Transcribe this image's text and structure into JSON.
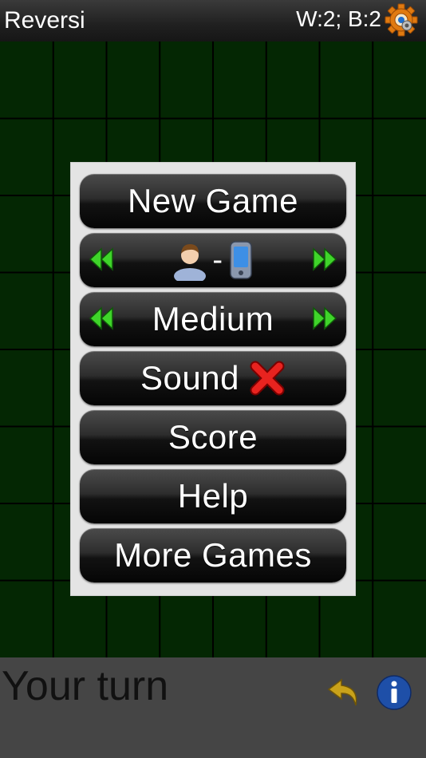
{
  "header": {
    "title": "Reversi",
    "score": "W:2; B:2",
    "settings_icon": "gear-icon"
  },
  "menu": {
    "new_game": "New Game",
    "mode": {
      "player_icon": "person-icon",
      "separator": "-",
      "opponent_icon": "phone-icon",
      "prev_icon": "double-left-arrow-icon",
      "next_icon": "double-right-arrow-icon"
    },
    "difficulty": {
      "label": "Medium",
      "prev_icon": "double-left-arrow-icon",
      "next_icon": "double-right-arrow-icon"
    },
    "sound": {
      "label": "Sound",
      "state_icon": "red-x-icon"
    },
    "score": "Score",
    "help": "Help",
    "more_games": "More Games"
  },
  "status": {
    "turn": "Your turn",
    "undo_icon": "undo-arrow-icon",
    "info_icon": "info-icon"
  },
  "colors": {
    "board": "#042703",
    "grid_line": "#000000",
    "arrow_green": "#3fd42a",
    "info_blue": "#1e4fa8",
    "undo_gold": "#c9a21a"
  }
}
